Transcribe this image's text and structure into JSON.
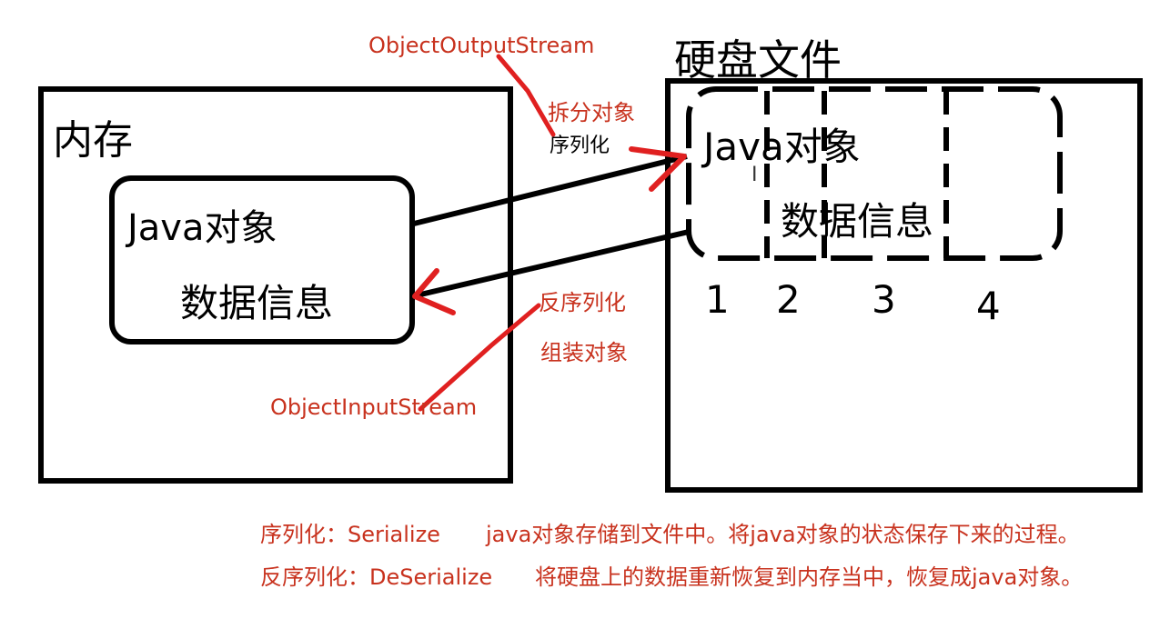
{
  "memory": {
    "title": "内存",
    "object_line1": "Java对象",
    "object_line2": "数据信息"
  },
  "disk": {
    "title": "硬盘文件",
    "object_line1": "Java对象",
    "object_line2": "数据信息",
    "segment_numbers": [
      "1",
      "2",
      "3",
      "4"
    ]
  },
  "labels": {
    "output_stream": "ObjectOutputStream",
    "split_object": "拆分对象",
    "serialize": "序列化",
    "deserialize": "反序列化",
    "assemble_object": "组装对象",
    "input_stream": "ObjectInputStream"
  },
  "descriptions": [
    {
      "term": "序列化：Serialize",
      "text": "java对象存储到文件中。将java对象的状态保存下来的过程。"
    },
    {
      "term": "反序列化：DeSerialize",
      "text": "将硬盘上的数据重新恢复到内存当中，恢复成java对象。"
    }
  ],
  "colors": {
    "annotation_red": "#c8321e",
    "line_black": "#000000"
  }
}
